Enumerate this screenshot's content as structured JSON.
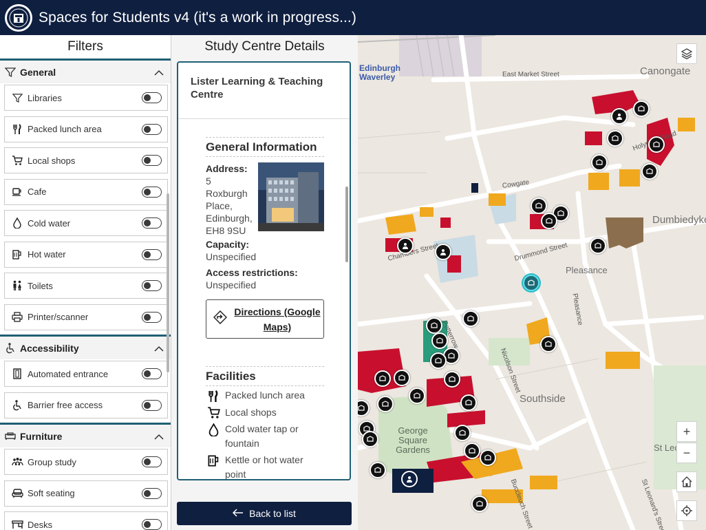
{
  "app": {
    "title": "Spaces for Students v4 (it's a work in progress...)"
  },
  "colors": {
    "header": "#0f1f40",
    "accent": "#1e5f73",
    "selected_pin": "#2bb9c6",
    "university_building": "#c8102e",
    "other_building": "#f0a81e"
  },
  "filters": {
    "title": "Filters",
    "groups": [
      {
        "label": "General",
        "icon": "filter-icon",
        "expanded": true,
        "items": [
          {
            "label": "Libraries",
            "icon": "filter-icon",
            "on": false
          },
          {
            "label": "Packed lunch area",
            "icon": "fork-knife-icon",
            "on": false
          },
          {
            "label": "Local shops",
            "icon": "cart-icon",
            "on": false
          },
          {
            "label": "Cafe",
            "icon": "coffee-cup-icon",
            "on": false
          },
          {
            "label": "Cold water",
            "icon": "water-drop-icon",
            "on": false
          },
          {
            "label": "Hot water",
            "icon": "kettle-icon",
            "on": false
          },
          {
            "label": "Toilets",
            "icon": "toilets-icon",
            "on": false
          },
          {
            "label": "Printer/scanner",
            "icon": "printer-icon",
            "on": false
          }
        ]
      },
      {
        "label": "Accessibility",
        "icon": "wheelchair-icon",
        "expanded": true,
        "items": [
          {
            "label": "Automated entrance",
            "icon": "door-icon",
            "on": false
          },
          {
            "label": "Barrier free access",
            "icon": "wheelchair-icon",
            "on": false
          }
        ]
      },
      {
        "label": "Furniture",
        "icon": "sofa-icon",
        "expanded": true,
        "items": [
          {
            "label": "Group study",
            "icon": "group-icon",
            "on": false
          },
          {
            "label": "Soft seating",
            "icon": "armchair-icon",
            "on": false
          },
          {
            "label": "Desks",
            "icon": "desk-icon",
            "on": false
          }
        ]
      }
    ]
  },
  "details": {
    "title": "Study Centre Details",
    "centre_name": "Lister Learning & Teaching Centre",
    "general_heading": "General Information",
    "address_label": "Address:",
    "address_value": "5 Roxburgh Place, Edinburgh, EH8 9SU",
    "capacity_label": "Capacity:",
    "capacity_value": "Unspecified",
    "access_label": "Access restrictions:",
    "access_value": "Unspecified",
    "directions_label": "Directions (Google Maps)",
    "facilities_heading": "Facilities",
    "facilities": [
      {
        "label": "Packed lunch area",
        "icon": "fork-knife-icon"
      },
      {
        "label": "Local shops",
        "icon": "cart-icon"
      },
      {
        "label": "Cold water tap or fountain",
        "icon": "water-drop-icon"
      },
      {
        "label": "Kettle or hot water point",
        "icon": "kettle-icon"
      }
    ],
    "back_label": "Back to list"
  },
  "map": {
    "place_labels": [
      "Canongate",
      "Edinburgh Waverley",
      "Dumbiedykes",
      "Pleasance",
      "Southside",
      "George Square Gardens",
      "St Leonard"
    ],
    "street_labels": [
      "East Market Street",
      "Cowgate",
      "Holyrood Road",
      "Drummond Street",
      "Chambers Street",
      "Potterrow",
      "Nicolson Street",
      "Pleasance",
      "Buccleuch Street",
      "St Leonard's Street"
    ],
    "controls": {
      "layers": "layers-icon",
      "zoom_in": "+",
      "zoom_out": "−",
      "home": "home-icon",
      "locate": "locate-icon"
    }
  }
}
